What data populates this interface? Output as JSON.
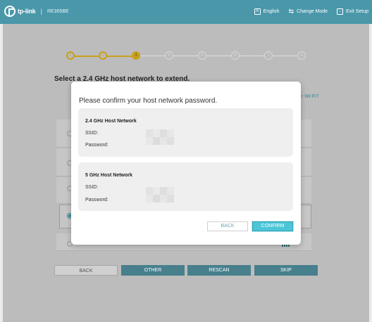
{
  "header": {
    "brand": "tp-link",
    "model": "RE365BE",
    "language": "English",
    "change_mode": "Change Mode",
    "exit_setup": "Exit Setup"
  },
  "progress": {
    "steps": [
      "✓",
      "✓",
      "3",
      "4",
      "5",
      "6",
      "7",
      "8"
    ],
    "current_step": 3
  },
  "page": {
    "title": "Select a 2.4 GHz host network to extend.",
    "wifi_link": "r Wi-Fi?"
  },
  "bottom_buttons": {
    "back": "BACK",
    "other": "OTHER",
    "rescan": "RESCAN",
    "skip": "SKIP"
  },
  "modal": {
    "title": "Please confirm your host network password.",
    "networks": [
      {
        "title": "2.4 GHz Host Network",
        "ssid_label": "SSID:",
        "password_label": "Password:"
      },
      {
        "title": "5 GHz Host Network",
        "ssid_label": "SSID:",
        "password_label": "Password:"
      }
    ],
    "back_label": "BACK",
    "confirm_label": "CONFIRM"
  },
  "colors": {
    "header": "#4a97aa",
    "accent": "#4dc5d6",
    "step_done": "#c8a11c"
  }
}
